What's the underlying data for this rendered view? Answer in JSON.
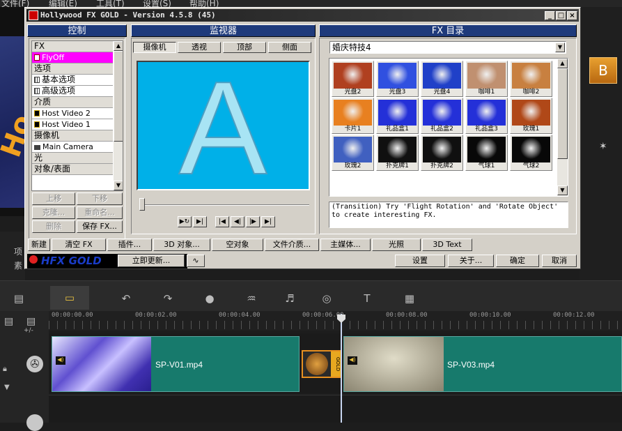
{
  "host": {
    "menu": [
      "文件(F)",
      "编辑(E)",
      "工具(T)",
      "设置(S)",
      "帮助(H)"
    ],
    "left_labels": [
      "项",
      "素"
    ],
    "right_tile": "B"
  },
  "dialog": {
    "title": "Hollywood FX GOLD - Version 4.5.8 (45)",
    "win_buttons": [
      "_",
      "□",
      "×"
    ],
    "control": {
      "header": "控制",
      "items": [
        {
          "label": "FX",
          "kind": "sec"
        },
        {
          "label": "FlyOff",
          "kind": "sel"
        },
        {
          "label": "选项",
          "kind": "sec"
        },
        {
          "label": "基本选项",
          "kind": "item"
        },
        {
          "label": "高级选项",
          "kind": "item"
        },
        {
          "label": "介质",
          "kind": "sec"
        },
        {
          "label": "Host Video 2",
          "kind": "item"
        },
        {
          "label": "Host Video 1",
          "kind": "item"
        },
        {
          "label": "摄像机",
          "kind": "sec"
        },
        {
          "label": "Main Camera",
          "kind": "item"
        },
        {
          "label": "光",
          "kind": "sec"
        },
        {
          "label": "对象/表面",
          "kind": "sec"
        }
      ],
      "buttons": {
        "move_up": "上移",
        "move_down": "下移",
        "clone": "克隆...",
        "rename": "重命名...",
        "delete": "删除",
        "save_fx": "保存 FX..."
      }
    },
    "monitor": {
      "header": "监视器",
      "tabs": [
        "摄像机",
        "透视",
        "顶部",
        "侧面"
      ],
      "active_tab": "摄像机",
      "preview_letter": "A",
      "slider_position": 0
    },
    "catalog": {
      "header": "FX 目录",
      "selected_category": "婚庆特技4",
      "effects": [
        {
          "label": "光盘2",
          "color": "#b04020"
        },
        {
          "label": "光盘3",
          "color": "#3050e0"
        },
        {
          "label": "光盘4",
          "color": "#2040c8"
        },
        {
          "label": "咖啡1",
          "color": "#c09070"
        },
        {
          "label": "咖啡2",
          "color": "#c88040"
        },
        {
          "label": "卡片1",
          "color": "#e88020"
        },
        {
          "label": "礼品盒1",
          "color": "#2430d8"
        },
        {
          "label": "礼品盒2",
          "color": "#2430d8"
        },
        {
          "label": "礼品盒3",
          "color": "#2430d8"
        },
        {
          "label": "玫瑰1",
          "color": "#b04818"
        },
        {
          "label": "玫瑰2",
          "color": "#4060c0"
        },
        {
          "label": "扑克牌1",
          "color": "#101010"
        },
        {
          "label": "扑克牌2",
          "color": "#101010"
        },
        {
          "label": "气球1",
          "color": "#080808"
        },
        {
          "label": "气球2",
          "color": "#080808"
        }
      ],
      "description": "(Transition) Try 'Flight Rotation' and 'Rotate Object' to create interesting FX."
    },
    "toolbar": [
      {
        "label": "新建",
        "w": 0
      },
      {
        "label": "清空 FX"
      },
      {
        "label": "插件..."
      },
      {
        "label": "3D 对象..."
      },
      {
        "label": "空对象"
      },
      {
        "label": "文件介质..."
      },
      {
        "label": "主媒体..."
      },
      {
        "label": "光照"
      },
      {
        "label": "3D Text"
      }
    ],
    "bottom": {
      "logo": "HFX GOLD",
      "update": "立即更新...",
      "settings": "设置",
      "about": "关于...",
      "ok": "确定",
      "cancel": "取消"
    }
  },
  "timeline": {
    "timecodes": [
      "00:00:00.00",
      "00:00:02.00",
      "00:00:04.00",
      "00:00:06.00",
      "00:00:08.00",
      "00:00:10.00",
      "00:00:12.00"
    ],
    "zoom_label": "+/-",
    "clips": [
      {
        "name": "SP-V01.mp4"
      },
      {
        "name": "SP-V03.mp4"
      }
    ],
    "transition_label": "GOLD"
  }
}
